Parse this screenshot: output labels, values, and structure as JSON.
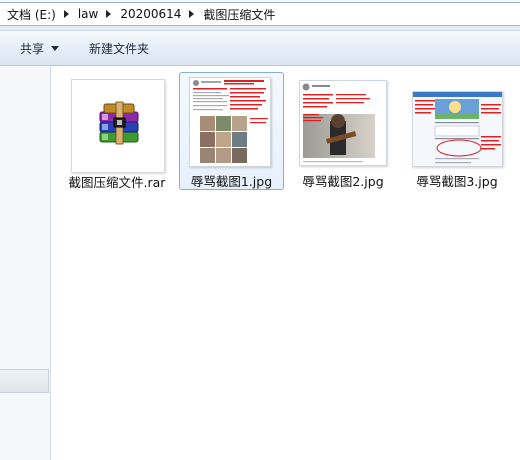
{
  "breadcrumb": {
    "items": [
      "文档 (E:)",
      "law",
      "20200614",
      "截图压缩文件"
    ]
  },
  "toolbar": {
    "share_label": "共享",
    "new_folder_label": "新建文件夹"
  },
  "files": [
    {
      "name": "截图压缩文件.rar",
      "icon": "winrar-archive-icon",
      "selected": false
    },
    {
      "name": "辱骂截图1.jpg",
      "icon": "image-thumbnail",
      "selected": true
    },
    {
      "name": "辱骂截图2.jpg",
      "icon": "image-thumbnail",
      "selected": false
    },
    {
      "name": "辱骂截图3.jpg",
      "icon": "image-thumbnail",
      "selected": false
    }
  ],
  "colors": {
    "selection_border": "#84acdd",
    "selection_fill": "#e6f0fb",
    "annotation_red": "#e02020"
  }
}
